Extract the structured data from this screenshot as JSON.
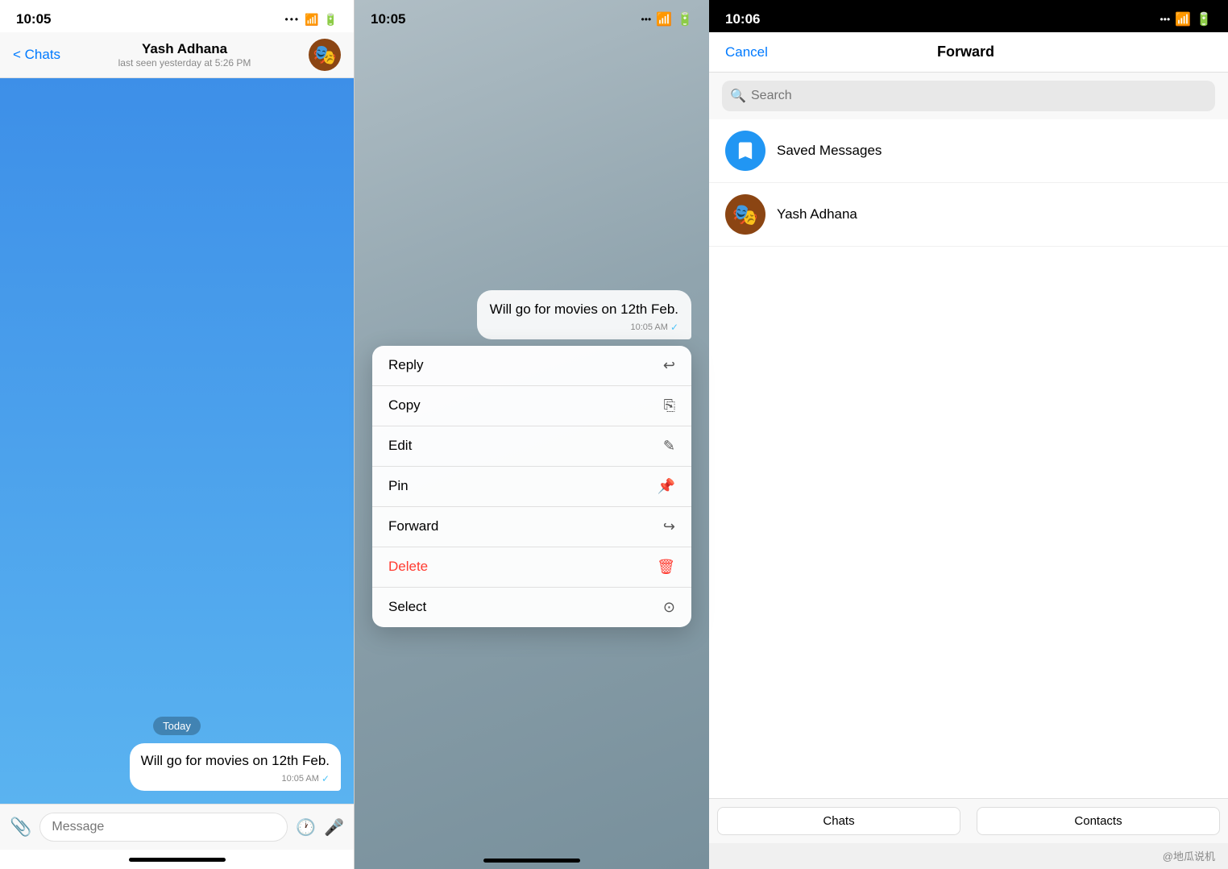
{
  "panel1": {
    "status_time": "10:05",
    "nav": {
      "back_label": "< Chats",
      "user_name": "Yash Adhana",
      "user_status": "last seen yesterday at 5:26 PM"
    },
    "messages": [
      {
        "text": "Will go for movies on 12th Feb.",
        "time": "10:05 AM",
        "check": "✓"
      }
    ],
    "today_label": "Today",
    "input_placeholder": "Message"
  },
  "panel2": {
    "status_time": "10:05",
    "bubble": {
      "text": "Will go for movies on 12th Feb.",
      "time": "10:05 AM",
      "check": "✓"
    },
    "menu_items": [
      {
        "label": "Reply",
        "icon": "↩",
        "delete": false
      },
      {
        "label": "Copy",
        "icon": "⎘",
        "delete": false
      },
      {
        "label": "Edit",
        "icon": "✎",
        "delete": false
      },
      {
        "label": "Pin",
        "icon": "📌",
        "delete": false
      },
      {
        "label": "Forward",
        "icon": "↪",
        "delete": false
      },
      {
        "label": "Delete",
        "icon": "🗑",
        "delete": true
      },
      {
        "label": "Select",
        "icon": "✓",
        "delete": false
      }
    ]
  },
  "panel3": {
    "status_time": "10:06",
    "nav": {
      "cancel_label": "Cancel",
      "title": "Forward"
    },
    "search_placeholder": "Search",
    "contacts": [
      {
        "name": "Saved Messages",
        "type": "saved"
      },
      {
        "name": "Yash Adhana",
        "type": "yash"
      }
    ],
    "tabs": [
      {
        "label": "Chats"
      },
      {
        "label": "Contacts"
      }
    ],
    "watermark": "@地瓜说机"
  }
}
